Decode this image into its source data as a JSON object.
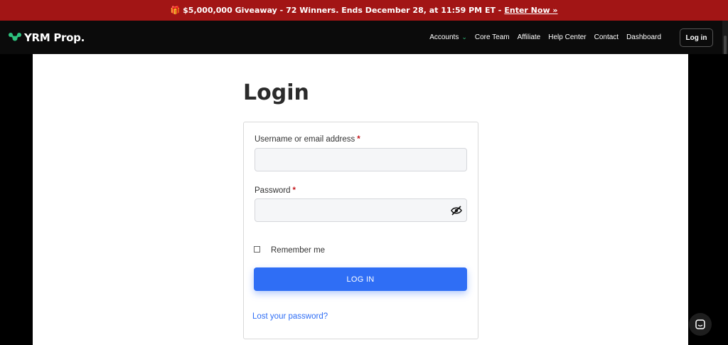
{
  "promo": {
    "text": "$5,000,000 Giveaway - 72 Winners. Ends December 28, at 11:59 PM ET - ",
    "link": "Enter Now »",
    "gift_icon": "gift-icon"
  },
  "nav": {
    "logo_text": "YRM Prop.",
    "brand_color": "#2ec27e",
    "items": [
      {
        "label": "Accounts",
        "has_dropdown": true
      },
      {
        "label": "Core Team"
      },
      {
        "label": "Affiliate"
      },
      {
        "label": "Help Center"
      },
      {
        "label": "Contact"
      },
      {
        "label": "Dashboard"
      }
    ],
    "login_label": "Log in"
  },
  "page": {
    "title": "Login"
  },
  "form": {
    "username_label": "Username or email address",
    "password_label": "Password",
    "required_mark": "*",
    "username_value": "",
    "password_value": "",
    "remember_label": "Remember me",
    "remember_checked": false,
    "submit_label": "LOG IN",
    "lost_password": "Lost your password?",
    "accent_color": "#2f6ef5"
  },
  "chat": {
    "icon": "chat-icon"
  }
}
